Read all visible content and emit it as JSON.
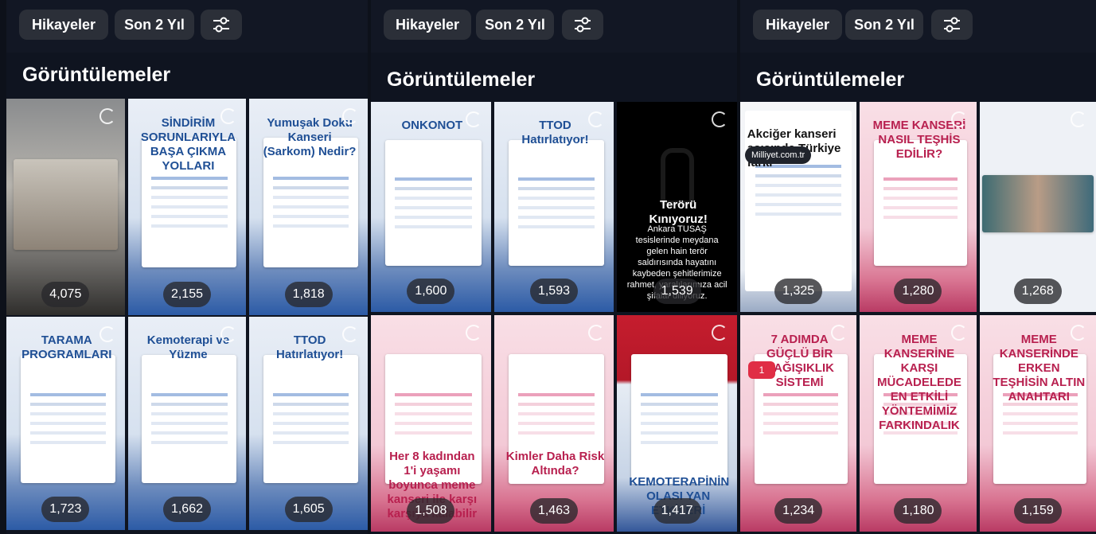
{
  "panels": [
    {
      "chips": [
        "Hikayeler",
        "Son 2 Yıl"
      ],
      "filter_icon": "sliders-icon",
      "title": "Görüntülemeler",
      "tiles": [
        {
          "count": "4,075",
          "style": "photo",
          "text": ""
        },
        {
          "count": "2,155",
          "style": "plain",
          "text": "SİNDİRİM SORUNLARIYLA BAŞA ÇIKMA YOLLARI"
        },
        {
          "count": "1,818",
          "style": "plain",
          "text": "Yumuşak Doku Kanseri (Sarkom) Nedir?"
        },
        {
          "count": "1,723",
          "style": "plain",
          "text": "TARAMA PROGRAMLARI"
        },
        {
          "count": "1,662",
          "style": "plain",
          "text": "Kemoterapi ve Yüzme"
        },
        {
          "count": "1,605",
          "style": "plain",
          "text": "TTOD Hatırlatıyor!"
        }
      ]
    },
    {
      "chips": [
        "Hikayeler",
        "Son 2 Yıl"
      ],
      "filter_icon": "sliders-icon",
      "title": "Görüntülemeler",
      "tiles": [
        {
          "count": "1,600",
          "style": "plain",
          "text": "ONKONOT"
        },
        {
          "count": "1,593",
          "style": "plain",
          "text": "TTOD Hatırlatıyor!"
        },
        {
          "count": "1,539",
          "style": "dark",
          "text": "Terörü Kınıyoruz!",
          "caption": "Ankara TUSAŞ tesislerinde meydana gelen hain terör saldırısında hayatını kaybeden şehitlerimize rahmet, yaralılarımıza acil şifalar diliyoruz."
        },
        {
          "count": "1,508",
          "style": "pink",
          "text": "Her 8 kadından 1'i yaşamı boyunca meme kanseri ile karşı karşıya kalabilir"
        },
        {
          "count": "1,463",
          "style": "pink",
          "text": "Kimler Daha Risk Altında?"
        },
        {
          "count": "1,417",
          "style": "red",
          "text": "KEMOTERAPİNİN OLASI YAN ETKİLERİ"
        }
      ]
    },
    {
      "chips": [
        "Hikayeler",
        "Son 2 Yıl"
      ],
      "filter_icon": "sliders-icon",
      "title": "Görüntülemeler",
      "tiles": [
        {
          "count": "1,325",
          "style": "news",
          "text": "Akciğer kanseri aşısında Türkiye farkı",
          "link": "Milliyet.com.tr"
        },
        {
          "count": "1,280",
          "style": "pink",
          "text": "MEME KANSERİ NASIL TEŞHİS EDİLİR?"
        },
        {
          "count": "1,268",
          "style": "gallery",
          "text": ""
        },
        {
          "count": "1,234",
          "style": "pink",
          "text": "7 ADIMDA GÜÇLÜ BİR BAĞIŞIKLIK SİSTEMİ",
          "badge": "1"
        },
        {
          "count": "1,180",
          "style": "pink",
          "text": "MEME KANSERİNE KARŞI MÜCADELEDE EN ETKİLİ YÖNTEMİMİZ FARKINDALIK"
        },
        {
          "count": "1,159",
          "style": "pink",
          "text": "MEME KANSERİNDE ERKEN TEŞHİSİN ALTIN ANAHTARI"
        }
      ]
    }
  ]
}
